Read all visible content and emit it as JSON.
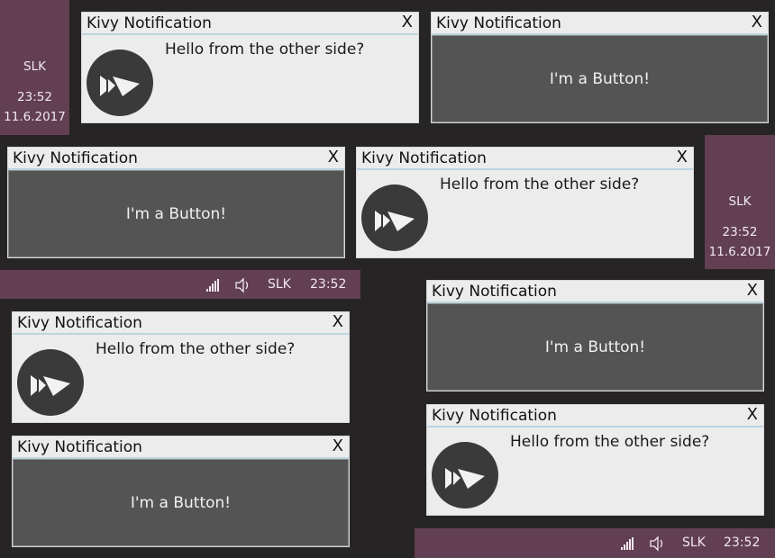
{
  "notification": {
    "title": "Kivy Notification",
    "close": "X",
    "message": "Hello from the other side?",
    "button": "I'm a Button!"
  },
  "sidebar": {
    "label": "SLK",
    "time": "23:52",
    "date": "11.6.2017"
  },
  "taskbar": {
    "label": "SLK",
    "time": "23:52",
    "signal_icon": "signal-bars-icon",
    "volume_icon": "speaker-icon"
  },
  "colors": {
    "background": "#262424",
    "accent": "#623f52",
    "button": "#545454",
    "title_rule": "#bcd4e0",
    "logo": "#3a3a3a"
  }
}
